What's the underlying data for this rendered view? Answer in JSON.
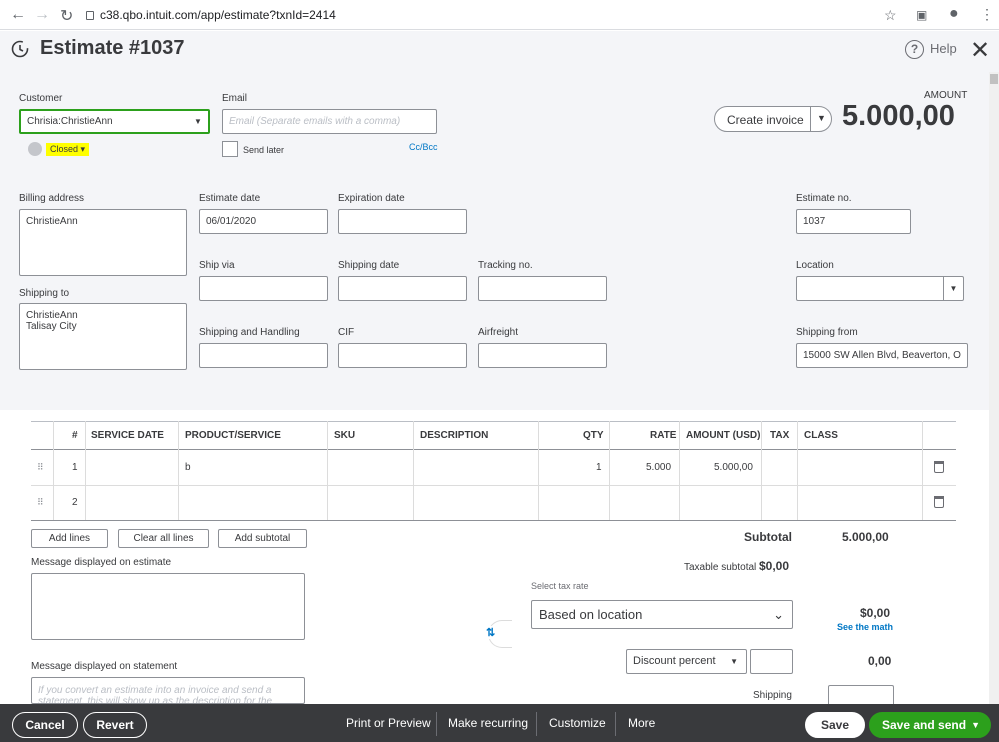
{
  "browser": {
    "url": "c38.qbo.intuit.com/app/estimate?txnId=2414"
  },
  "header": {
    "title": "Estimate #1037",
    "help": "Help"
  },
  "customer": {
    "label": "Customer",
    "value": "Chrisia:ChristieAnn",
    "status": "Closed"
  },
  "email": {
    "label": "Email",
    "placeholder": "Email (Separate emails with a comma)",
    "send_later": "Send later",
    "cc_bcc": "Cc/Bcc"
  },
  "actions": {
    "create_invoice": "Create invoice"
  },
  "amount": {
    "label": "AMOUNT",
    "value": "5.000,00"
  },
  "billing": {
    "label": "Billing address",
    "value": "ChristieAnn"
  },
  "shipping_to": {
    "label": "Shipping to",
    "line1": "ChristieAnn",
    "line2": "Talisay City"
  },
  "estimate_date": {
    "label": "Estimate date",
    "value": "06/01/2020"
  },
  "expiration_date": {
    "label": "Expiration date",
    "value": ""
  },
  "estimate_no": {
    "label": "Estimate no.",
    "value": "1037"
  },
  "ship_via": {
    "label": "Ship via"
  },
  "shipping_date": {
    "label": "Shipping date"
  },
  "tracking_no": {
    "label": "Tracking no."
  },
  "location": {
    "label": "Location"
  },
  "shipping_handling": {
    "label": "Shipping and Handling"
  },
  "cif": {
    "label": "CIF"
  },
  "airfreight": {
    "label": "Airfreight"
  },
  "shipping_from": {
    "label": "Shipping from",
    "value": "15000 SW Allen Blvd, Beaverton, O"
  },
  "table": {
    "headers": [
      "#",
      "SERVICE DATE",
      "PRODUCT/SERVICE",
      "SKU",
      "DESCRIPTION",
      "QTY",
      "RATE",
      "AMOUNT (USD)",
      "TAX",
      "CLASS"
    ],
    "rows": [
      {
        "num": "1",
        "service_date": "",
        "product": "b",
        "sku": "",
        "description": "",
        "qty": "1",
        "rate": "5.000",
        "amount": "5.000,00",
        "tax": "",
        "class": ""
      },
      {
        "num": "2",
        "service_date": "",
        "product": "",
        "sku": "",
        "description": "",
        "qty": "",
        "rate": "",
        "amount": "",
        "tax": "",
        "class": ""
      }
    ]
  },
  "table_buttons": {
    "add_lines": "Add lines",
    "clear_all": "Clear all lines",
    "add_subtotal": "Add subtotal"
  },
  "message_estimate": {
    "label": "Message displayed on estimate"
  },
  "message_statement": {
    "label": "Message displayed on statement",
    "placeholder": "If you convert an estimate into an invoice and send a statement, this will show up as the description for the"
  },
  "totals": {
    "subtotal_label": "Subtotal",
    "subtotal_value": "5.000,00",
    "taxable_label": "Taxable subtotal",
    "taxable_value": "$0,00",
    "tax_rate_label": "Select tax rate",
    "tax_rate_value": "Based on location",
    "tax_value": "$0,00",
    "see_math": "See the math",
    "discount_label": "Discount percent",
    "discount_value": "0,00",
    "shipping_label": "Shipping"
  },
  "footer": {
    "cancel": "Cancel",
    "revert": "Revert",
    "print": "Print or Preview",
    "recurring": "Make recurring",
    "customize": "Customize",
    "more": "More",
    "save": "Save",
    "save_send": "Save and send"
  }
}
